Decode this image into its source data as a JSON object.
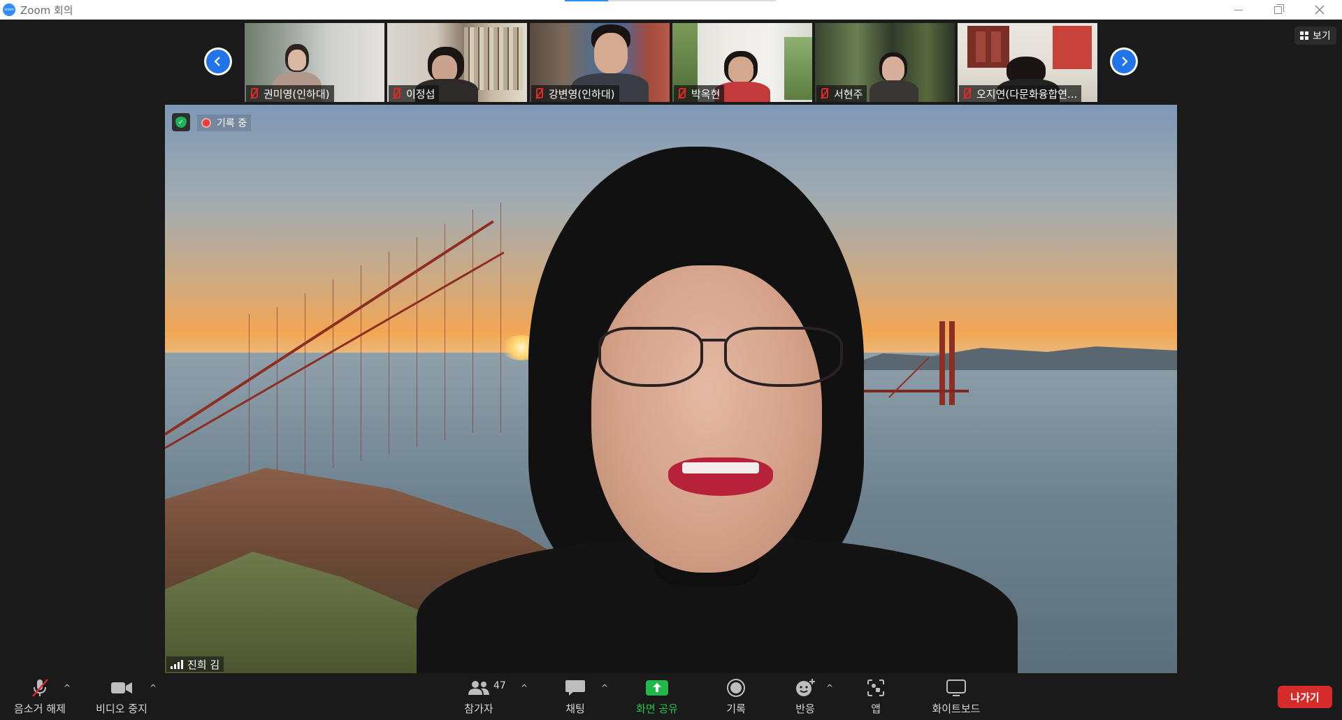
{
  "window": {
    "title": "Zoom 회의",
    "logo_text": "zoom"
  },
  "view_button": {
    "label": "보기"
  },
  "thumbnails": [
    {
      "name": "권미영(인하대)",
      "muted": true
    },
    {
      "name": "이정섭",
      "muted": true
    },
    {
      "name": "강변영(인하대)",
      "muted": true
    },
    {
      "name": "박옥현",
      "muted": true
    },
    {
      "name": "서현주",
      "muted": true
    },
    {
      "name": "오지연(다문화융합연...",
      "muted": true
    }
  ],
  "main_video": {
    "recording_label": "기록 중",
    "speaker_name": "진희 김"
  },
  "toolbar": {
    "unmute": "음소거 해제",
    "stop_video": "비디오 중지",
    "participants": "참가자",
    "participant_count": "47",
    "chat": "채팅",
    "share": "화면 공유",
    "record": "기록",
    "reactions": "반응",
    "apps": "앱",
    "whiteboard": "화이트보드",
    "leave": "나가기"
  },
  "colors": {
    "accent_blue": "#2d8cff",
    "share_green": "#27c24d",
    "leave_red": "#d52b2b",
    "mute_red": "#e02828",
    "secure_green": "#1eb25a"
  }
}
